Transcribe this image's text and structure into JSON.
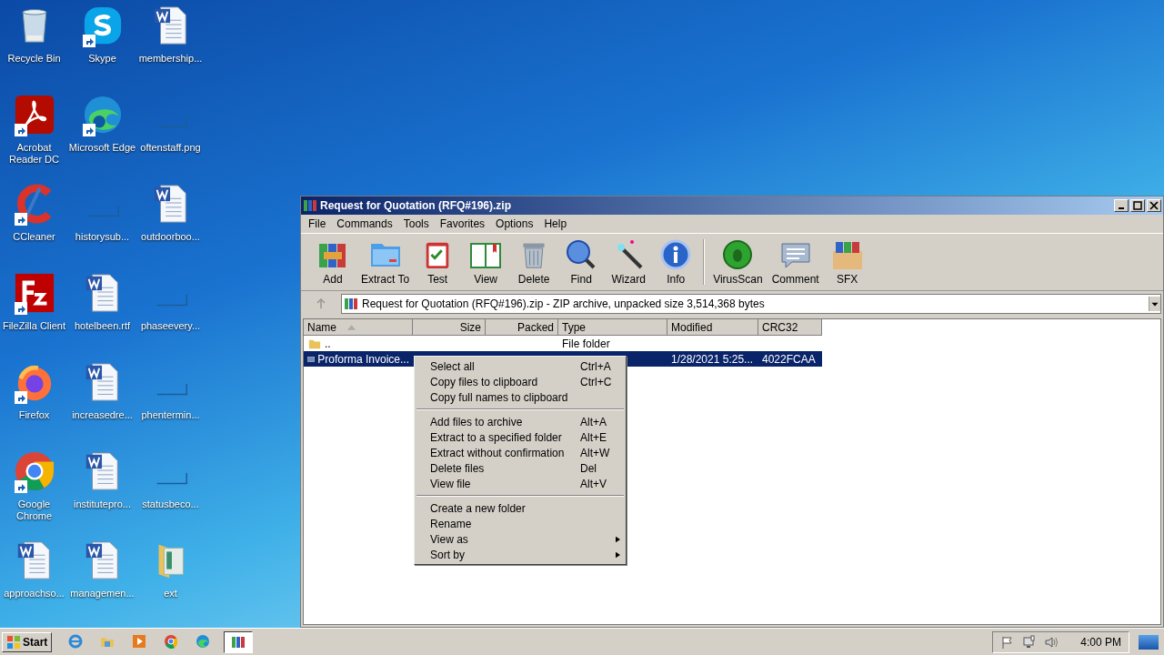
{
  "desktop_icons": [
    {
      "label": "Recycle Bin",
      "kind": "recycle",
      "shortcut": false
    },
    {
      "label": "Acrobat Reader DC",
      "kind": "acrobat",
      "shortcut": true
    },
    {
      "label": "CCleaner",
      "kind": "ccleaner",
      "shortcut": true
    },
    {
      "label": "FileZilla Client",
      "kind": "filezilla",
      "shortcut": true
    },
    {
      "label": "Firefox",
      "kind": "firefox",
      "shortcut": true
    },
    {
      "label": "Google Chrome",
      "kind": "chrome",
      "shortcut": true
    },
    {
      "label": "approachso...",
      "kind": "word",
      "shortcut": false
    },
    {
      "label": "Skype",
      "kind": "skype",
      "shortcut": true
    },
    {
      "label": "Microsoft Edge",
      "kind": "edge",
      "shortcut": true
    },
    {
      "label": "historysub...",
      "kind": "blank",
      "shortcut": false
    },
    {
      "label": "hotelbeen.rtf",
      "kind": "word",
      "shortcut": false
    },
    {
      "label": "increasedre...",
      "kind": "word",
      "shortcut": false
    },
    {
      "label": "institutepro...",
      "kind": "word",
      "shortcut": false
    },
    {
      "label": "managemen...",
      "kind": "word",
      "shortcut": false
    },
    {
      "label": "membership...",
      "kind": "word",
      "shortcut": false
    },
    {
      "label": "oftenstaff.png",
      "kind": "blank",
      "shortcut": false
    },
    {
      "label": "outdoorboo...",
      "kind": "word",
      "shortcut": false
    },
    {
      "label": "phaseevery...",
      "kind": "blank",
      "shortcut": false
    },
    {
      "label": "phentermin...",
      "kind": "blank",
      "shortcut": false
    },
    {
      "label": "statusbeco...",
      "kind": "blank",
      "shortcut": false
    },
    {
      "label": "ext",
      "kind": "folder",
      "shortcut": false
    }
  ],
  "window": {
    "title": "Request for Quotation (RFQ#196).zip",
    "menu": [
      "File",
      "Commands",
      "Tools",
      "Favorites",
      "Options",
      "Help"
    ],
    "toolbar": [
      {
        "label": "Add",
        "kind": "add"
      },
      {
        "label": "Extract To",
        "kind": "extract"
      },
      {
        "label": "Test",
        "kind": "test"
      },
      {
        "label": "View",
        "kind": "view"
      },
      {
        "label": "Delete",
        "kind": "delete"
      },
      {
        "label": "Find",
        "kind": "find"
      },
      {
        "label": "Wizard",
        "kind": "wizard"
      },
      {
        "label": "Info",
        "kind": "info"
      },
      {
        "label": "VirusScan",
        "kind": "virus"
      },
      {
        "label": "Comment",
        "kind": "comment"
      },
      {
        "label": "SFX",
        "kind": "sfx"
      }
    ],
    "address": "Request for Quotation (RFQ#196).zip - ZIP archive, unpacked size 3,514,368 bytes",
    "table": {
      "columns": [
        "Name",
        "Size",
        "Packed",
        "Type",
        "Modified",
        "CRC32"
      ],
      "rows": [
        {
          "kind": "folder",
          "name": "..",
          "type": "File folder",
          "selected": false
        },
        {
          "kind": "file",
          "name": "Proforma Invoice...",
          "modified": "1/28/2021 5:25...",
          "crc": "4022FCAA",
          "selected": true
        }
      ]
    }
  },
  "context_menu": {
    "groups": [
      [
        {
          "label": "Select all",
          "shortcut": "Ctrl+A",
          "submenu": false
        },
        {
          "label": "Copy files to clipboard",
          "shortcut": "Ctrl+C",
          "submenu": false
        },
        {
          "label": "Copy full names to clipboard",
          "submenu": false
        }
      ],
      [
        {
          "label": "Add files to archive",
          "shortcut": "Alt+A",
          "submenu": false
        },
        {
          "label": "Extract to a specified folder",
          "shortcut": "Alt+E",
          "submenu": false
        },
        {
          "label": "Extract without confirmation",
          "shortcut": "Alt+W",
          "submenu": false
        },
        {
          "label": "Delete files",
          "shortcut": "Del",
          "submenu": false
        },
        {
          "label": "View file",
          "shortcut": "Alt+V",
          "submenu": false
        }
      ],
      [
        {
          "label": "Create a new folder",
          "submenu": false
        },
        {
          "label": "Rename",
          "submenu": false
        },
        {
          "label": "View as",
          "submenu": true
        },
        {
          "label": "Sort by",
          "submenu": true
        }
      ]
    ]
  },
  "taskbar": {
    "start": "Start",
    "apps": [
      {
        "kind": "ie",
        "selected": false
      },
      {
        "kind": "explorer",
        "selected": false
      },
      {
        "kind": "media",
        "selected": false
      },
      {
        "kind": "chrome",
        "selected": false
      },
      {
        "kind": "edge",
        "selected": false
      },
      {
        "kind": "winrar",
        "selected": true
      }
    ],
    "tray": [
      {
        "kind": "flag"
      },
      {
        "kind": "network"
      },
      {
        "kind": "volume"
      }
    ],
    "clock": "4:00 PM"
  }
}
